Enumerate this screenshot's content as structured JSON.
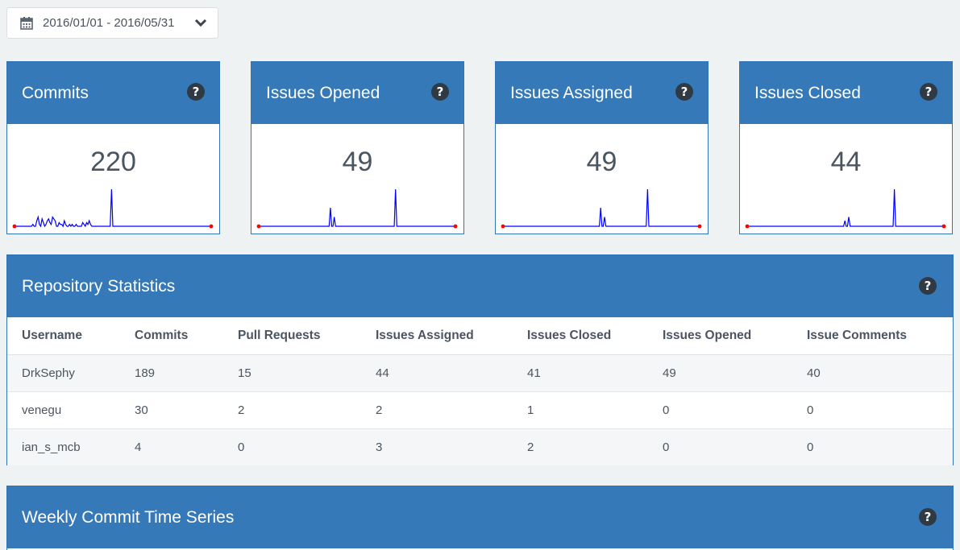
{
  "date_range": {
    "icon": "calendar-icon",
    "label": "2016/01/01 - 2016/05/31",
    "dropdown_icon": "chevron-down-icon"
  },
  "colors": {
    "header_blue": "#3679b9",
    "spark_line": "#0000ff",
    "spark_dot": "#ff0000",
    "help_icon": "#2f3a44"
  },
  "cards": [
    {
      "title": "Commits",
      "value": "220",
      "help_icon": "question-icon",
      "series": [
        0,
        0,
        0,
        0,
        0,
        0,
        0,
        0,
        0,
        0,
        0,
        0,
        0,
        0,
        1,
        0,
        0,
        3,
        5,
        1,
        0,
        4,
        2,
        0,
        1,
        3,
        4,
        2,
        1,
        5,
        4,
        3,
        0,
        0,
        2,
        1,
        1,
        0,
        3,
        1,
        0,
        0,
        1,
        0,
        1,
        0,
        0,
        1,
        0,
        0,
        0,
        0,
        2,
        1,
        0,
        2,
        1,
        3,
        1,
        0,
        0,
        0,
        0,
        0,
        0,
        0,
        0,
        0,
        0,
        0,
        0,
        0,
        0,
        0,
        20,
        0,
        0,
        0,
        0,
        0,
        0,
        0,
        0,
        0,
        0,
        0,
        0,
        0,
        0,
        0,
        0,
        0,
        0,
        0,
        0,
        0,
        0,
        0,
        0,
        0,
        0,
        0,
        0,
        0,
        0,
        0,
        0,
        0,
        0,
        0,
        0,
        0,
        0,
        0,
        0,
        0,
        0,
        0,
        0,
        0,
        0,
        0,
        0,
        0,
        0,
        0,
        0,
        0,
        0,
        0,
        0,
        0,
        0,
        0,
        0,
        0,
        0,
        0,
        0,
        0,
        0,
        0,
        0,
        0,
        0,
        0,
        0,
        0,
        0,
        0,
        0
      ]
    },
    {
      "title": "Issues Opened",
      "value": "49",
      "help_icon": "question-icon",
      "series": [
        0,
        0,
        0,
        0,
        0,
        0,
        0,
        0,
        0,
        0,
        0,
        0,
        0,
        0,
        0,
        0,
        0,
        0,
        0,
        0,
        0,
        0,
        0,
        0,
        0,
        0,
        0,
        0,
        0,
        0,
        0,
        0,
        0,
        0,
        0,
        0,
        0,
        0,
        0,
        0,
        0,
        0,
        0,
        0,
        0,
        0,
        0,
        0,
        0,
        0,
        0,
        0,
        0,
        0,
        0,
        10,
        0,
        0,
        5,
        0,
        0,
        0,
        0,
        0,
        0,
        0,
        0,
        0,
        0,
        0,
        0,
        0,
        0,
        0,
        0,
        0,
        0,
        0,
        0,
        0,
        0,
        0,
        0,
        0,
        0,
        0,
        0,
        0,
        0,
        0,
        0,
        0,
        0,
        0,
        0,
        0,
        0,
        0,
        0,
        0,
        0,
        0,
        0,
        0,
        0,
        20,
        0,
        0,
        0,
        0,
        0,
        0,
        0,
        0,
        0,
        0,
        0,
        0,
        0,
        0,
        0,
        0,
        0,
        0,
        0,
        0,
        0,
        0,
        0,
        0,
        0,
        0,
        0,
        0,
        0,
        0,
        0,
        0,
        0,
        0,
        0,
        0,
        0,
        0,
        0,
        0,
        0,
        0,
        0,
        0,
        0,
        0
      ]
    },
    {
      "title": "Issues Assigned",
      "value": "49",
      "help_icon": "question-icon",
      "series": [
        0,
        0,
        0,
        0,
        0,
        0,
        0,
        0,
        0,
        0,
        0,
        0,
        0,
        0,
        0,
        0,
        0,
        0,
        0,
        0,
        0,
        0,
        0,
        0,
        0,
        0,
        0,
        0,
        0,
        0,
        0,
        0,
        0,
        0,
        0,
        0,
        0,
        0,
        0,
        0,
        0,
        0,
        0,
        0,
        0,
        0,
        0,
        0,
        0,
        0,
        0,
        0,
        0,
        0,
        0,
        0,
        0,
        0,
        0,
        0,
        0,
        0,
        0,
        0,
        0,
        0,
        0,
        0,
        0,
        0,
        0,
        0,
        0,
        0,
        0,
        10,
        0,
        0,
        5,
        0,
        0,
        0,
        0,
        0,
        0,
        0,
        0,
        0,
        0,
        0,
        0,
        0,
        0,
        0,
        0,
        0,
        0,
        0,
        0,
        0,
        0,
        0,
        0,
        0,
        0,
        0,
        0,
        0,
        0,
        0,
        0,
        20,
        0,
        0,
        0,
        0,
        0,
        0,
        0,
        0,
        0,
        0,
        0,
        0,
        0,
        0,
        0,
        0,
        0,
        0,
        0,
        0,
        0,
        0,
        0,
        0,
        0,
        0,
        0,
        0,
        0,
        0,
        0,
        0,
        0,
        0,
        0,
        0,
        0,
        0,
        0,
        0
      ]
    },
    {
      "title": "Issues Closed",
      "value": "44",
      "help_icon": "question-icon",
      "series": [
        0,
        0,
        0,
        0,
        0,
        0,
        0,
        0,
        0,
        0,
        0,
        0,
        0,
        0,
        0,
        0,
        0,
        0,
        0,
        0,
        0,
        0,
        0,
        0,
        0,
        0,
        0,
        0,
        0,
        0,
        0,
        0,
        0,
        0,
        0,
        0,
        0,
        0,
        0,
        0,
        0,
        0,
        0,
        0,
        0,
        0,
        0,
        0,
        0,
        0,
        0,
        0,
        0,
        0,
        0,
        0,
        0,
        0,
        0,
        0,
        0,
        0,
        0,
        0,
        0,
        0,
        0,
        0,
        0,
        0,
        0,
        0,
        0,
        0,
        0,
        3,
        0,
        0,
        5,
        0,
        0,
        0,
        0,
        0,
        0,
        0,
        0,
        0,
        0,
        0,
        0,
        0,
        0,
        0,
        0,
        0,
        0,
        0,
        0,
        0,
        0,
        0,
        0,
        0,
        0,
        0,
        0,
        0,
        0,
        0,
        0,
        0,
        0,
        20,
        0,
        0,
        0,
        0,
        0,
        0,
        0,
        0,
        0,
        0,
        0,
        0,
        0,
        0,
        0,
        0,
        0,
        0,
        0,
        0,
        0,
        0,
        0,
        0,
        0,
        0,
        0,
        0,
        0,
        0,
        0,
        0,
        0,
        0,
        0,
        0,
        0,
        0
      ]
    }
  ],
  "repo_stats": {
    "title": "Repository Statistics",
    "help_icon": "question-icon",
    "columns": [
      "Username",
      "Commits",
      "Pull Requests",
      "Issues Assigned",
      "Issues Closed",
      "Issues Opened",
      "Issue Comments"
    ],
    "rows": [
      [
        "DrkSephy",
        "189",
        "15",
        "44",
        "41",
        "49",
        "40"
      ],
      [
        "venegu",
        "30",
        "2",
        "2",
        "1",
        "0",
        "0"
      ],
      [
        "ian_s_mcb",
        "4",
        "0",
        "3",
        "2",
        "0",
        "0"
      ]
    ]
  },
  "weekly": {
    "title": "Weekly Commit Time Series",
    "help_icon": "question-icon"
  }
}
